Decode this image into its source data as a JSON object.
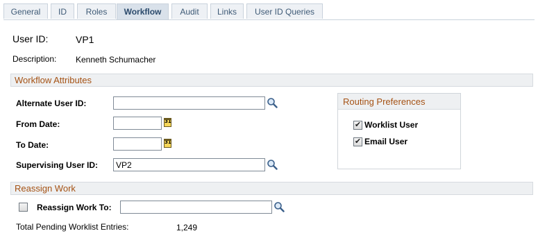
{
  "tabs": [
    {
      "label": "General",
      "active": false
    },
    {
      "label": "ID",
      "active": false
    },
    {
      "label": "Roles",
      "active": false
    },
    {
      "label": "Workflow",
      "active": true
    },
    {
      "label": "Audit",
      "active": false
    },
    {
      "label": "Links",
      "active": false
    },
    {
      "label": "User ID Queries",
      "active": false
    }
  ],
  "header": {
    "user_id_label": "User ID:",
    "user_id_value": "VP1",
    "description_label": "Description:",
    "description_value": "Kenneth Schumacher"
  },
  "workflow_attributes": {
    "title": "Workflow Attributes",
    "alternate_user_id_label": "Alternate User ID:",
    "alternate_user_id_value": "",
    "from_date_label": "From Date:",
    "from_date_value": "",
    "to_date_label": "To Date:",
    "to_date_value": "",
    "supervising_user_id_label": "Supervising User ID:",
    "supervising_user_id_value": "VP2",
    "calendar_glyph": "31"
  },
  "routing_preferences": {
    "title": "Routing Preferences",
    "worklist_user_label": "Worklist User",
    "worklist_user_checked": true,
    "email_user_label": "Email User",
    "email_user_checked": true,
    "check_glyph": "✔"
  },
  "reassign_work": {
    "title": "Reassign Work",
    "reassign_checked": false,
    "reassign_to_label": "Reassign Work To:",
    "reassign_to_value": "",
    "pending_label": "Total Pending Worklist Entries:",
    "pending_value": "1,249"
  },
  "icons": {
    "lookup": "magnifier-icon",
    "calendar": "calendar-icon"
  },
  "colors": {
    "section_title": "#a55214",
    "tab_text": "#3e5a76",
    "section_bg": "#eef0f2"
  }
}
